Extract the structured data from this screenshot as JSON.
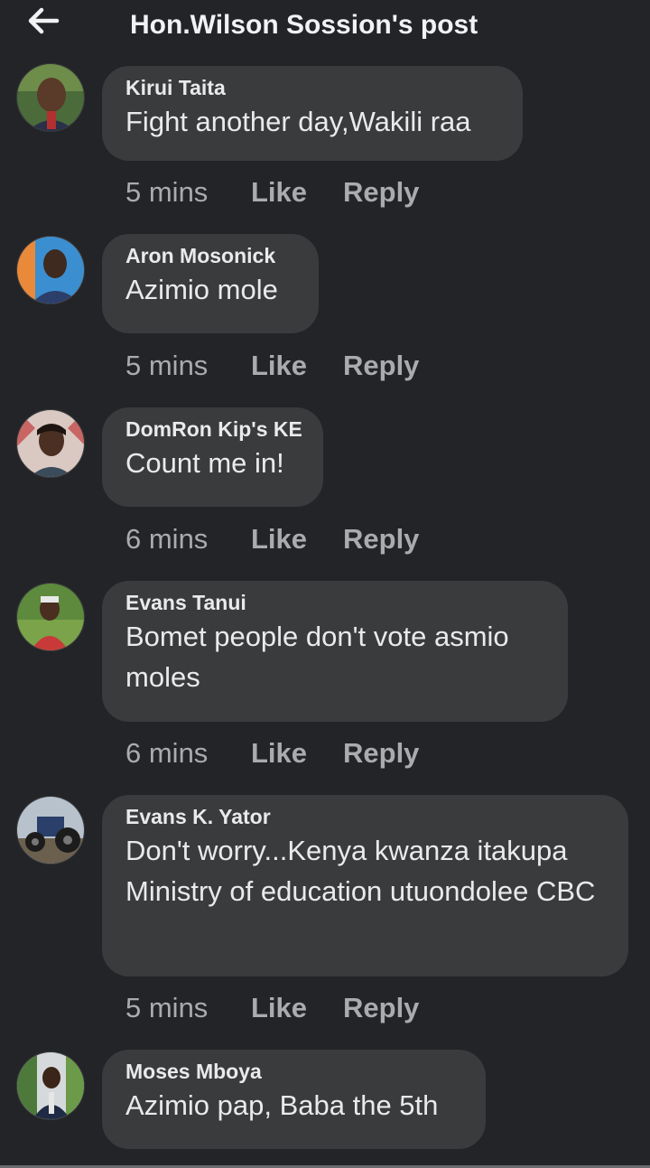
{
  "header": {
    "back_icon": "arrow-left-icon",
    "title": "Hon.Wilson Sossion's post"
  },
  "actions": {
    "like": "Like",
    "reply": "Reply"
  },
  "comments": [
    {
      "author": "Kirui Taita",
      "text": "Fight another day,Wakili raa",
      "time": "5 mins"
    },
    {
      "author": "Aron Mosonick",
      "text": "Azimio mole",
      "time": "5 mins"
    },
    {
      "author": "DomRon Kip's KE",
      "text": "Count me in!",
      "time": "6 mins"
    },
    {
      "author": "Evans Tanui",
      "text": "Bomet people don't vote asmio moles",
      "time": "6 mins"
    },
    {
      "author": "Evans K. Yator",
      "text": "Don't worry...Kenya kwanza itakupa Ministry of education utuondolee CBC",
      "time": "5 mins"
    },
    {
      "author": "Moses Mboya",
      "text": "Azimio pap, Baba the 5th",
      "time": ""
    }
  ],
  "colors": {
    "background": "#232427",
    "bubble": "#3a3b3d",
    "text": "#e9eaec",
    "meta": "#a9abaf"
  }
}
